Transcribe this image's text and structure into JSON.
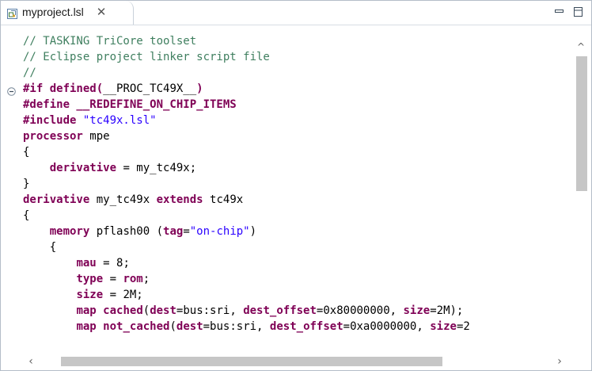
{
  "tab": {
    "icon": "linker-script-file-icon",
    "title": "myproject.lsl",
    "close_glyph": "✕"
  },
  "window_buttons": {
    "minimize_icon": "minimize-icon",
    "maximize_icon": "maximize-icon"
  },
  "editor": {
    "lines": [
      [
        {
          "t": "// TASKING TriCore toolset",
          "c": "comment"
        }
      ],
      [
        {
          "t": "// Eclipse project linker script file",
          "c": "comment"
        }
      ],
      [
        {
          "t": "//",
          "c": "comment"
        }
      ],
      [
        {
          "t": "#if defined(",
          "c": "kw"
        },
        {
          "t": "__PROC_TC49X__",
          "c": "plain"
        },
        {
          "t": ")",
          "c": "kw"
        }
      ],
      [
        {
          "t": "#define __REDEFINE_ON_CHIP_ITEMS",
          "c": "kw"
        }
      ],
      [
        {
          "t": "#include ",
          "c": "kw"
        },
        {
          "t": "\"tc49x.lsl\"",
          "c": "str"
        }
      ],
      [
        {
          "t": "processor",
          "c": "kw"
        },
        {
          "t": " mpe",
          "c": "plain"
        }
      ],
      [
        {
          "t": "{",
          "c": "plain"
        }
      ],
      [
        {
          "t": "    ",
          "c": "plain"
        },
        {
          "t": "derivative",
          "c": "kw"
        },
        {
          "t": " = my_tc49x;",
          "c": "plain"
        }
      ],
      [
        {
          "t": "}",
          "c": "plain"
        }
      ],
      [
        {
          "t": "derivative",
          "c": "kw"
        },
        {
          "t": " my_tc49x ",
          "c": "plain"
        },
        {
          "t": "extends",
          "c": "kw"
        },
        {
          "t": " tc49x",
          "c": "plain"
        }
      ],
      [
        {
          "t": "{",
          "c": "plain"
        }
      ],
      [
        {
          "t": "    ",
          "c": "plain"
        },
        {
          "t": "memory",
          "c": "kw"
        },
        {
          "t": " pflash00 (",
          "c": "plain"
        },
        {
          "t": "tag",
          "c": "kw"
        },
        {
          "t": "=",
          "c": "plain"
        },
        {
          "t": "\"on-chip\"",
          "c": "str"
        },
        {
          "t": ")",
          "c": "plain"
        }
      ],
      [
        {
          "t": "    {",
          "c": "plain"
        }
      ],
      [
        {
          "t": "        ",
          "c": "plain"
        },
        {
          "t": "mau",
          "c": "kw"
        },
        {
          "t": " = 8;",
          "c": "plain"
        }
      ],
      [
        {
          "t": "        ",
          "c": "plain"
        },
        {
          "t": "type",
          "c": "kw"
        },
        {
          "t": " = ",
          "c": "plain"
        },
        {
          "t": "rom",
          "c": "kw"
        },
        {
          "t": ";",
          "c": "plain"
        }
      ],
      [
        {
          "t": "        ",
          "c": "plain"
        },
        {
          "t": "size",
          "c": "kw"
        },
        {
          "t": " = 2M;",
          "c": "plain"
        }
      ],
      [
        {
          "t": "        ",
          "c": "plain"
        },
        {
          "t": "map",
          "c": "kw"
        },
        {
          "t": " ",
          "c": "plain"
        },
        {
          "t": "cached",
          "c": "kw"
        },
        {
          "t": "(",
          "c": "plain"
        },
        {
          "t": "dest",
          "c": "kw"
        },
        {
          "t": "=bus:sri, ",
          "c": "plain"
        },
        {
          "t": "dest_offset",
          "c": "kw"
        },
        {
          "t": "=0x80000000, ",
          "c": "plain"
        },
        {
          "t": "size",
          "c": "kw"
        },
        {
          "t": "=2M);",
          "c": "plain"
        }
      ],
      [
        {
          "t": "        ",
          "c": "plain"
        },
        {
          "t": "map",
          "c": "kw"
        },
        {
          "t": " ",
          "c": "plain"
        },
        {
          "t": "not_cached",
          "c": "kw"
        },
        {
          "t": "(",
          "c": "plain"
        },
        {
          "t": "dest",
          "c": "kw"
        },
        {
          "t": "=bus:sri, ",
          "c": "plain"
        },
        {
          "t": "dest_offset",
          "c": "kw"
        },
        {
          "t": "=0xa0000000, ",
          "c": "plain"
        },
        {
          "t": "size",
          "c": "kw"
        },
        {
          "t": "=2",
          "c": "plain"
        }
      ]
    ],
    "fold_marker_line": 3,
    "fold_marker_icon": "collapse-icon"
  },
  "scrollbars": {
    "up_glyph": "^",
    "left_glyph": "‹",
    "right_glyph": "›"
  },
  "colors": {
    "comment": "#3f7f5f",
    "keyword": "#7f0055",
    "string": "#2a00ff",
    "scroll_thumb": "#c6c6c6"
  }
}
